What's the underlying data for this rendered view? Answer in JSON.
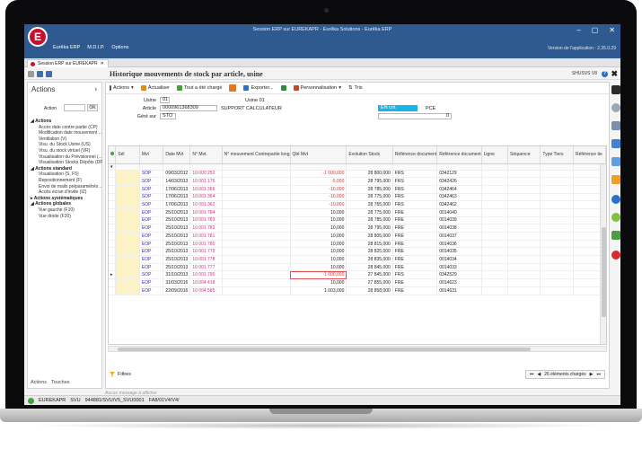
{
  "window": {
    "title": "Session ERP sur EUREKAPR - Eurêka Solutions - Eurêka ERP",
    "logo_letter": "E",
    "version": "Version de l'application : 2.35.0.29",
    "menu": [
      "Eurêka ERP",
      "M.D.I.P.",
      "Options"
    ]
  },
  "tab": {
    "label": "Session ERP sur EUREKAPR",
    "close": "✕"
  },
  "page": {
    "title": "Historique mouvements de stock par article, usine",
    "user": "SHUSVS V8",
    "help": "?",
    "close": "✖"
  },
  "left_panel": {
    "title": "Actions",
    "pin": "⇟",
    "action_label": "Action",
    "ok_label": "OK",
    "sections": [
      {
        "label": "Actions",
        "items": [
          "Accès date contre partie (CP)",
          "Modification date mouvement ...",
          "Ventilation (V)",
          "Visu. du Stock Usine (US)",
          "Visu. du stock virtuel (VR)",
          "Visualisation du Prévisionnel (...",
          "Visualisation Stocks Dépôts (DP)"
        ]
      },
      {
        "label": "Actions standard",
        "items": [
          "Visualisation (S, F5)",
          "Repositionnement (F)",
          "Envoi de mails préparamétrés ...",
          "Accès écran d'invite (IZ)"
        ]
      },
      {
        "label": "Actions systématiques",
        "items": []
      },
      {
        "label": "Actions globales",
        "items": [
          "Vue gauche (F10)",
          "Vue droite (F20)"
        ]
      }
    ],
    "bottom_tabs": [
      "Actions",
      "Touches"
    ]
  },
  "toolbar": {
    "actions": "Actions",
    "refresh": "Actualiser",
    "all_loaded": "Tout a été chargé",
    "export": "Exporter...",
    "custom": "Personnalisation",
    "sort": "Tris"
  },
  "fields": {
    "usine_label": "Usine",
    "usine_value": "01",
    "usine_name": "Usine 01",
    "article_label": "Article",
    "article_value": "0000961368309",
    "article_name": "SUPPORT CALCULATEUR",
    "gere_label": "Géré sur",
    "gere_value": "STO",
    "unit_tag": "EN cnt",
    "unit": "PCE",
    "qty": "0"
  },
  "grid": {
    "headers": [
      "Sél",
      "Mvt",
      "Date Mvt",
      "N° Mvt.",
      "N° mouvement Contrepartie long",
      "Qté Mvt",
      "Evolution Stock",
      "Référence document",
      "Référence document",
      "Ligne",
      "Séquence",
      "Type Tiers",
      "Référence tie"
    ],
    "rows": [
      [
        "",
        "SOP",
        "09/03/2012",
        "10 000 252",
        "",
        "-1 000,000",
        "28 800,000",
        "FRS",
        "0342129",
        "",
        "",
        "",
        ""
      ],
      [
        "",
        "SOP",
        "14/03/2013",
        "10 001 176",
        "",
        "-5,000",
        "28 795,000",
        "FRS",
        "0342426",
        "",
        "",
        "",
        ""
      ],
      [
        "",
        "SOP",
        "17/06/2013",
        "10 001 366",
        "",
        "-10,000",
        "28 785,000",
        "FRS",
        "0342464",
        "",
        "",
        "",
        ""
      ],
      [
        "",
        "SOP",
        "17/06/2013",
        "10 001 364",
        "",
        "-10,000",
        "28 775,000",
        "FRS",
        "0342463",
        "",
        "",
        "",
        ""
      ],
      [
        "",
        "SOP",
        "17/06/2013",
        "10 001 362",
        "",
        "-10,000",
        "28 765,000",
        "FRS",
        "0342462",
        "",
        "",
        "",
        ""
      ],
      [
        "",
        "EOP",
        "25/10/2013",
        "10 001 784",
        "",
        "10,000",
        "28 775,000",
        "FRE",
        "0014040",
        "",
        "",
        "",
        ""
      ],
      [
        "",
        "EOP",
        "25/10/2013",
        "10 001 783",
        "",
        "10,000",
        "28 785,000",
        "FRE",
        "0014039",
        "",
        "",
        "",
        ""
      ],
      [
        "",
        "EOP",
        "25/10/2013",
        "10 001 782",
        "",
        "10,000",
        "28 795,000",
        "FRE",
        "0014038",
        "",
        "",
        "",
        ""
      ],
      [
        "",
        "EOP",
        "25/10/2013",
        "10 001 781",
        "",
        "10,000",
        "28 805,000",
        "FRE",
        "0014037",
        "",
        "",
        "",
        ""
      ],
      [
        "",
        "EOP",
        "25/10/2013",
        "10 001 780",
        "",
        "10,000",
        "28 815,000",
        "FRE",
        "0014036",
        "",
        "",
        "",
        ""
      ],
      [
        "",
        "EOP",
        "25/10/2013",
        "10 001 779",
        "",
        "10,000",
        "28 825,000",
        "FRE",
        "0014035",
        "",
        "",
        "",
        ""
      ],
      [
        "",
        "EOP",
        "25/10/2013",
        "10 001 778",
        "",
        "10,000",
        "28 835,000",
        "FRE",
        "0014034",
        "",
        "",
        "",
        ""
      ],
      [
        "",
        "EOP",
        "25/10/2013",
        "10 001 777",
        "",
        "10,000",
        "28 845,000",
        "FRE",
        "0014033",
        "",
        "",
        "",
        ""
      ],
      [
        "",
        "SOP",
        "31/10/2013",
        "10 001 790",
        "",
        "-1 000,000",
        "27 845,000",
        "FRS",
        "0342529",
        "",
        "",
        "",
        ""
      ],
      [
        "",
        "EOP",
        "31/03/2016",
        "10 004 418",
        "",
        "10,000",
        "27 855,000",
        "FRE",
        "0014623",
        "",
        "",
        "",
        ""
      ],
      [
        "",
        "EOP",
        "22/09/2016",
        "10 004 585",
        "",
        "1 003,000",
        "28 858,000",
        "FRE",
        "0014631",
        "",
        "",
        "",
        ""
      ]
    ]
  },
  "footer": {
    "filters": "Filtres",
    "pager_count": "26 éléments chargés",
    "message": "Aucun message à afficher"
  },
  "statusbar": {
    "items": [
      "EUREKAPR",
      "SVU",
      "944881/SVU/V5_SVU0001",
      "FA8/01V4/V4/"
    ]
  }
}
